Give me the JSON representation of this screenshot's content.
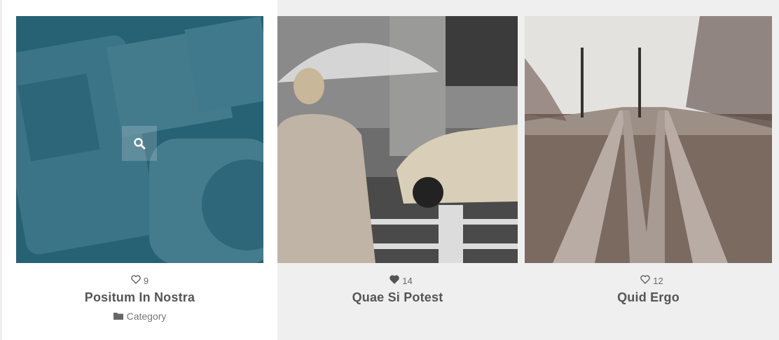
{
  "colors": {
    "overlay": "#23667d",
    "page_background": "#efefef",
    "active_card": "#ffffff"
  },
  "items": [
    {
      "likes": "9",
      "liked": false,
      "title": "Positum In Nostra",
      "category": "Category",
      "image": "laptop-notebook-coffee-desk-photo",
      "hover": true
    },
    {
      "likes": "14",
      "liked": true,
      "title": "Quae Si Potest",
      "image": "woman-umbrella-taxi-street-photo"
    },
    {
      "likes": "12",
      "liked": false,
      "title": "Quid Ergo",
      "image": "railway-tracks-photo"
    }
  ],
  "icons": {
    "zoom": "search-icon",
    "like": "heart-icon",
    "category": "folder-icon"
  }
}
